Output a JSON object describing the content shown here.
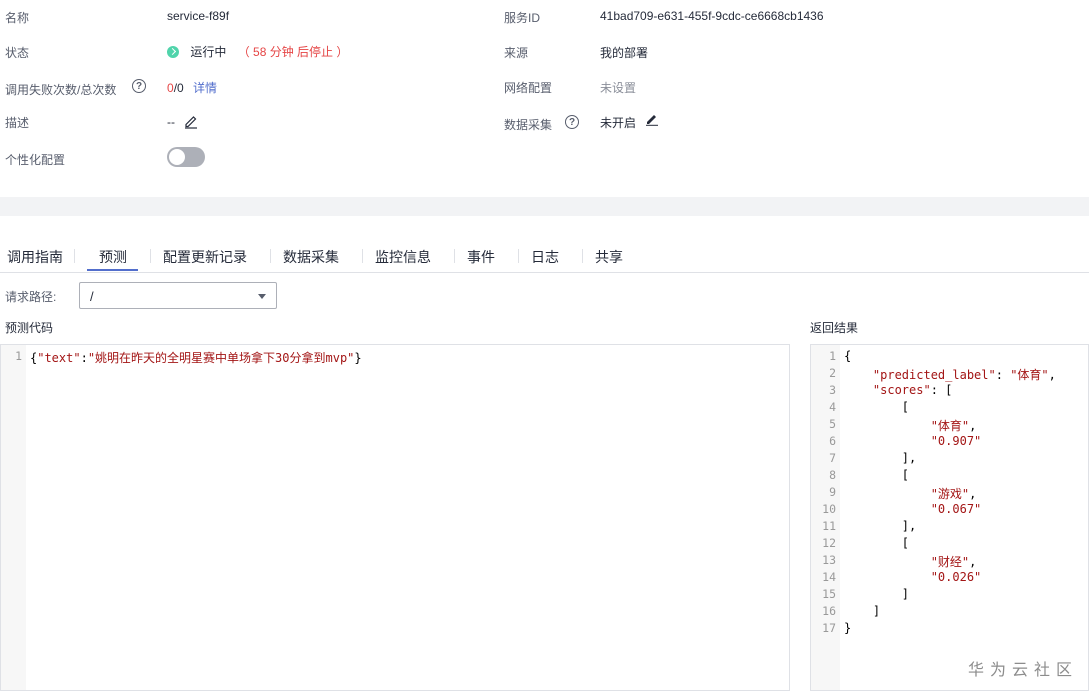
{
  "info": {
    "name_label": "名称",
    "name_value": "service-f89f",
    "service_id_label": "服务ID",
    "service_id_value": "41bad709-e631-455f-9cdc-ce6668cb1436",
    "status_label": "状态",
    "status_value": "运行中",
    "status_note": "（ 58 分钟 后停止 ）",
    "source_label": "来源",
    "source_value": "我的部署",
    "fail_label": "调用失败次数/总次数",
    "fail_count": "0",
    "total_count": "/0",
    "details_link": "详情",
    "network_label": "网络配置",
    "network_value": "未设置",
    "desc_label": "描述",
    "desc_value": "--",
    "data_collect_label": "数据采集",
    "data_collect_value": "未开启",
    "personal_label": "个性化配置",
    "help_icon_text": "?"
  },
  "tabs": [
    {
      "label": "调用指南"
    },
    {
      "label": "预测"
    },
    {
      "label": "配置更新记录"
    },
    {
      "label": "数据采集"
    },
    {
      "label": "监控信息"
    },
    {
      "label": "事件"
    },
    {
      "label": "日志"
    },
    {
      "label": "共享"
    }
  ],
  "active_tab": "预测",
  "request": {
    "path_label": "请求路径:",
    "path_value": "/"
  },
  "predict_code": {
    "title": "预测代码",
    "lines": [
      {
        "num": "1",
        "text": "{\"text\":\"姚明在昨天的全明星赛中单场拿下30分拿到mvp\"}"
      }
    ]
  },
  "result": {
    "title": "返回结果",
    "lines": [
      {
        "num": "1",
        "text": "{"
      },
      {
        "num": "2",
        "text": "    \"predicted_label\": \"体育\","
      },
      {
        "num": "3",
        "text": "    \"scores\": ["
      },
      {
        "num": "4",
        "text": "        ["
      },
      {
        "num": "5",
        "text": "            \"体育\","
      },
      {
        "num": "6",
        "text": "            \"0.907\""
      },
      {
        "num": "7",
        "text": "        ],"
      },
      {
        "num": "8",
        "text": "        ["
      },
      {
        "num": "9",
        "text": "            \"游戏\","
      },
      {
        "num": "10",
        "text": "            \"0.067\""
      },
      {
        "num": "11",
        "text": "        ],"
      },
      {
        "num": "12",
        "text": "        ["
      },
      {
        "num": "13",
        "text": "            \"财经\","
      },
      {
        "num": "14",
        "text": "            \"0.026\""
      },
      {
        "num": "15",
        "text": "        ]"
      },
      {
        "num": "16",
        "text": "    ]"
      },
      {
        "num": "17",
        "text": "}"
      }
    ]
  },
  "watermark": "华为云社区",
  "colors": {
    "accent": "#526ecc",
    "status_running": "#50d4ab",
    "warning_text": "#e54545",
    "link": "#526ecc"
  }
}
